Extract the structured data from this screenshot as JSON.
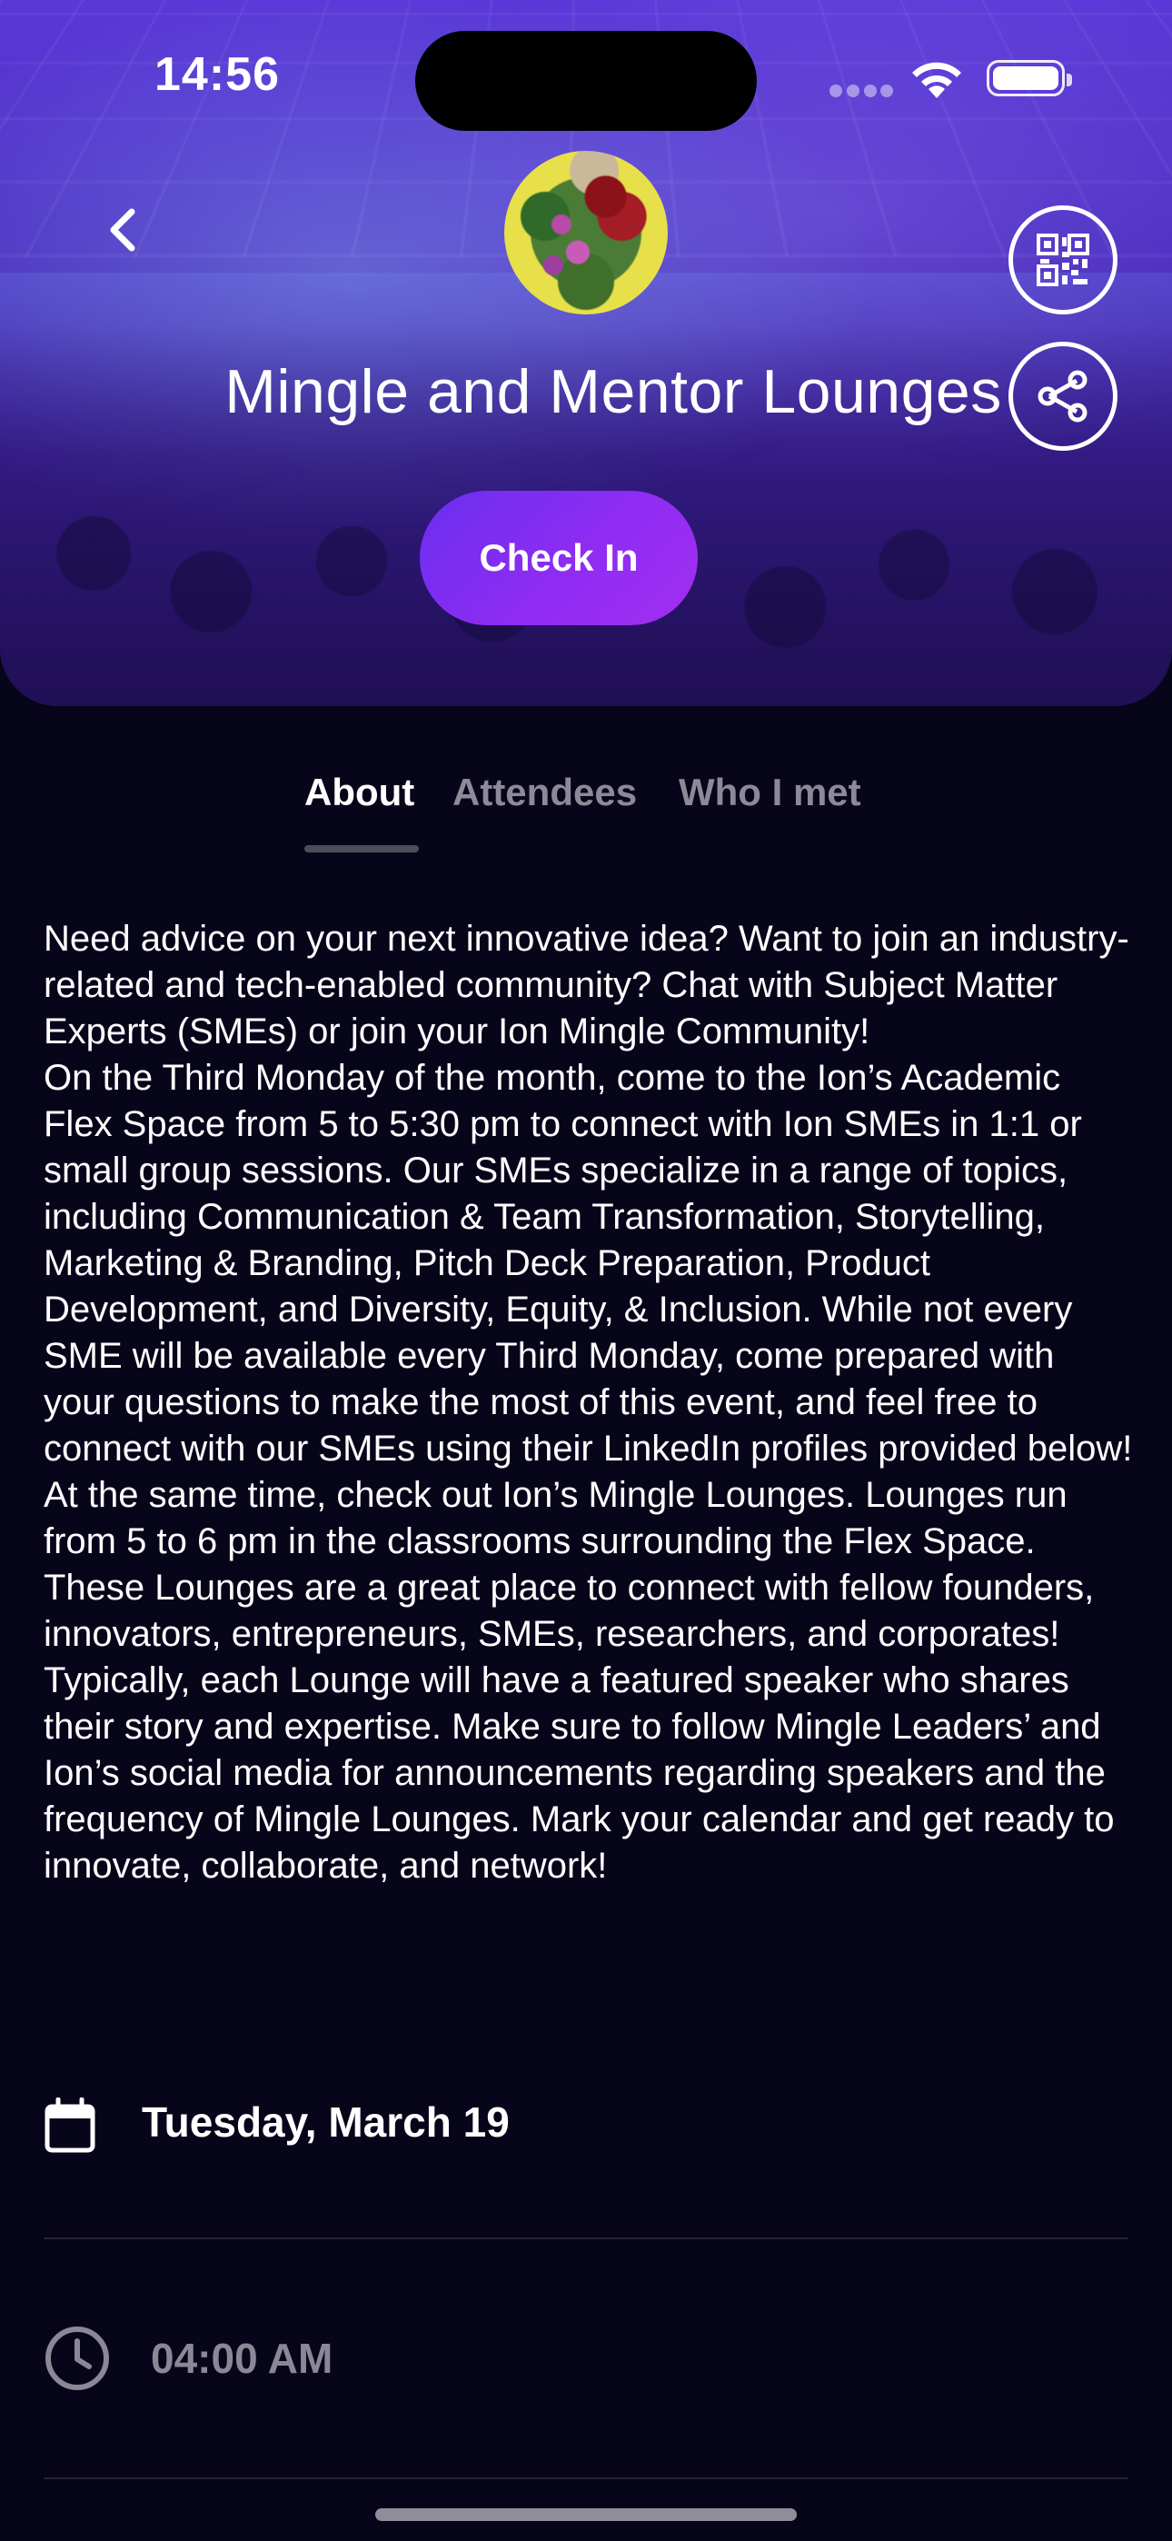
{
  "status_bar": {
    "time": "14:56"
  },
  "header": {
    "title": "Mingle and Mentor Lounges",
    "back_icon": "chevron-left-icon",
    "qr_icon": "qr-code-icon",
    "share_icon": "share-icon"
  },
  "actions": {
    "check_in_label": "Check In"
  },
  "tabs": [
    {
      "label": "About",
      "active": true
    },
    {
      "label": "Attendees",
      "active": false
    },
    {
      "label": "Who I met",
      "active": false
    }
  ],
  "about": {
    "description": "Need advice on your next innovative idea? Want to join an industry-related and tech-enabled community? Chat with Subject Matter Experts (SMEs) or join your Ion Mingle Community!\nOn the Third Monday of the month, come to the Ion’s Academic Flex Space from 5 to 5:30 pm to connect with Ion SMEs in 1:1 or small group sessions. Our SMEs specialize in a range of topics, including Communication & Team Transformation, Storytelling, Marketing & Branding, Pitch Deck Preparation, Product Development, and Diversity, Equity, & Inclusion. While not every SME will be available every Third Monday, come prepared with your questions to make the most of this event, and feel free to connect with our SMEs using their LinkedIn profiles provided below!\nAt the same time, check out Ion’s Mingle Lounges. Lounges run from 5 to 6 pm in the classrooms surrounding the Flex Space. These Lounges are a great place to connect with fellow founders, innovators, entrepreneurs, SMEs, researchers, and corporates! Typically, each Lounge will have a featured speaker who shares their story and expertise. Make sure to follow Mingle Leaders’ and Ion’s social media for announcements regarding speakers and the frequency of Mingle Lounges. Mark your calendar and get ready to innovate, collaborate, and network!"
  },
  "details": {
    "date": "Tuesday, March 19",
    "date_icon": "calendar-icon",
    "time": "04:00 AM",
    "time_icon": "clock-icon"
  },
  "colors": {
    "background": "#07051a",
    "accent": "#8f2cf2",
    "tab_inactive": "#8c8a98"
  }
}
